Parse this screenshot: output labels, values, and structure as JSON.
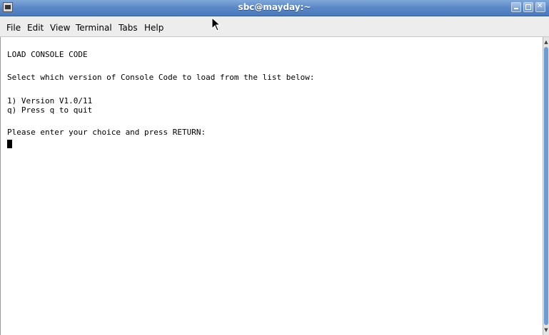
{
  "window": {
    "title": "sbc@mayday:~"
  },
  "menu": {
    "items": [
      {
        "label": "File"
      },
      {
        "label": "Edit"
      },
      {
        "label": "View"
      },
      {
        "label": "Terminal"
      },
      {
        "label": "Tabs"
      },
      {
        "label": "Help"
      }
    ]
  },
  "terminal": {
    "lines": [
      "LOAD CONSOLE CODE",
      "Select which version of Console Code to load from the list below:",
      "1) Version V1.0/11",
      "q) Press q to quit",
      "Please enter your choice and press RETURN:"
    ]
  },
  "icons": {
    "window_icon": "terminal-app-icon",
    "minimize": "minimize-icon",
    "maximize": "maximize-icon",
    "close": "close-icon",
    "pointer": "mouse-pointer-icon"
  },
  "colors": {
    "titlebar": "#5a87c6",
    "scroll_thumb": "#6f9bd3",
    "terminal_bg": "#ffffff",
    "terminal_fg": "#000000"
  }
}
